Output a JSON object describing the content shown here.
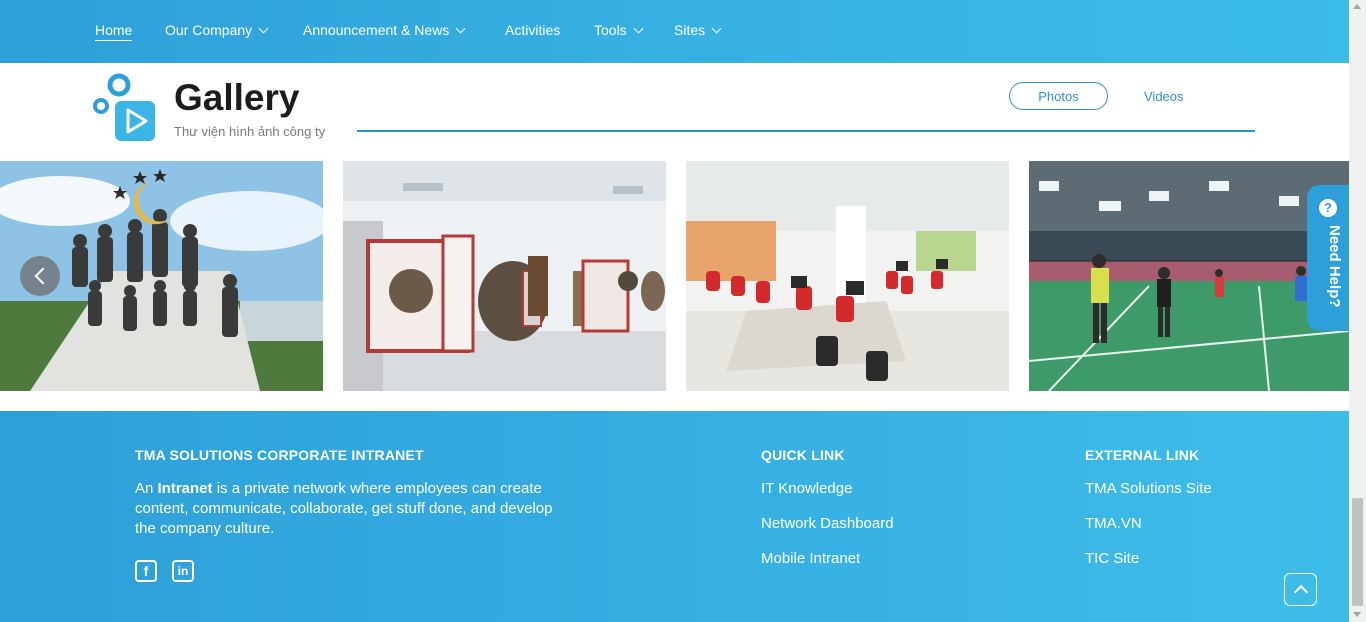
{
  "nav": {
    "items": [
      {
        "label": "Home",
        "active": true,
        "dropdown": false
      },
      {
        "label": "Our Company",
        "dropdown": true
      },
      {
        "label": "Announcement & News",
        "dropdown": true
      },
      {
        "label": "Activities",
        "dropdown": false
      },
      {
        "label": "Tools",
        "dropdown": true
      },
      {
        "label": "Sites",
        "dropdown": true
      }
    ]
  },
  "gallery": {
    "title": "Gallery",
    "subtitle": "Thư viện hình ảnh công ty",
    "tabs": {
      "photos": "Photos",
      "videos": "Videos"
    },
    "photos": [
      "team-outdoor-stairs",
      "museum-exhibit-hall",
      "office-workspace",
      "badminton-court"
    ],
    "icon": "play-video-icon"
  },
  "help": {
    "label": "Need Help?",
    "icon": "question-icon"
  },
  "footer": {
    "about": {
      "heading": "TMA SOLUTIONS CORPORATE INTRANET",
      "prefix": "An ",
      "bold": "Intranet",
      "text": " is a private network where employees can create content, communicate, collaborate, get stuff done, and develop the company culture."
    },
    "quick_link": {
      "heading": "QUICK LINK",
      "items": [
        "IT Knowledge",
        "Network Dashboard",
        "Mobile Intranet"
      ]
    },
    "external_link": {
      "heading": "EXTERNAL LINK",
      "items": [
        "TMA Solutions Site",
        "TMA.VN",
        "TIC Site"
      ]
    },
    "social": {
      "facebook": "f",
      "linkedin": "in"
    }
  },
  "colors": {
    "brand_blue": "#2e9fd8",
    "accent_blue": "#2f8fcf"
  }
}
